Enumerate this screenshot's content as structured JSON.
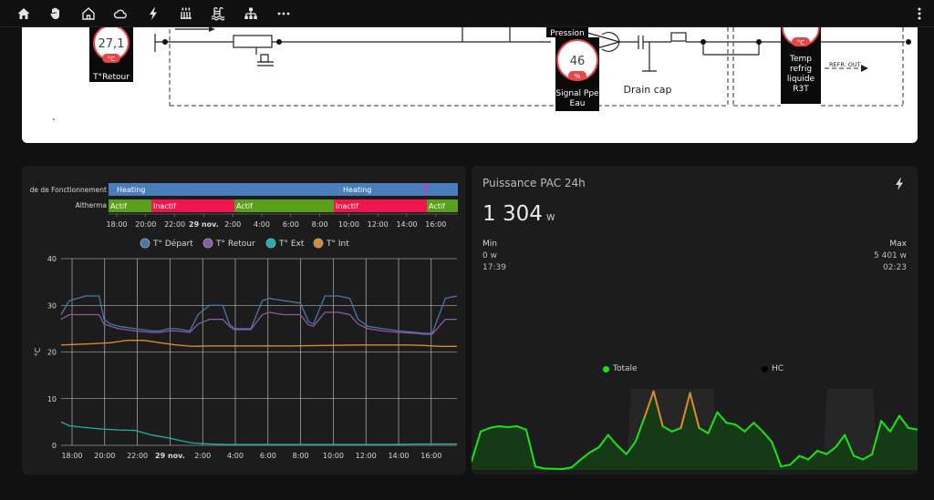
{
  "topbar": {
    "icons": [
      "home-icon",
      "hand-icon",
      "house-outline-icon",
      "cloud-icon",
      "lightning-icon",
      "radiator-icon",
      "pool-icon",
      "network-icon",
      "more-horizontal-icon"
    ],
    "menu_icon": "dots-vertical-icon"
  },
  "diagram": {
    "retour_value": "27,1",
    "retour_unit": "°C",
    "retour_label": "T°Retour",
    "pression_label": "Pression",
    "pump_value": "46",
    "pump_unit": "%",
    "pump_label_1": "Signal Ppe",
    "pump_label_2": "Eau",
    "drain_label": "Drain cap",
    "refrig_unit": "°C",
    "refrig_label_1": "Temp",
    "refrig_label_2": "refrig",
    "refrig_label_3": "liquide",
    "refrig_label_4": "R3T",
    "refr_out_label": "REFR. OUT"
  },
  "timeline": {
    "rows": [
      {
        "label": "de de Fonctionnement",
        "segments": [
          {
            "text": "Heating",
            "color": "#4a7ebb"
          },
          {
            "text": "Heating",
            "color": "#4a7ebb"
          }
        ]
      },
      {
        "label": "Altherma",
        "segments": [
          {
            "text": "Actif",
            "color": "#5a9e1a"
          },
          {
            "text": "Inactif",
            "color": "#f0154a"
          },
          {
            "text": "Actif",
            "color": "#5a9e1a"
          },
          {
            "text": "Inactif",
            "color": "#f0154a"
          },
          {
            "text": "Actif",
            "color": "#5a9e1a"
          }
        ]
      }
    ],
    "ticks": [
      "18:00",
      "20:00",
      "22:00",
      "29 nov.",
      "2:00",
      "4:00",
      "6:00",
      "8:00",
      "10:00",
      "12:00",
      "14:00",
      "16:00"
    ]
  },
  "chart_data": [
    {
      "type": "line",
      "ylabel": "°C",
      "ylim": [
        0,
        40
      ],
      "yticks": [
        "0",
        "10",
        "20",
        "30",
        "40"
      ],
      "x_ticks": [
        "18:00",
        "20:00",
        "22:00",
        "29 nov.",
        "2:00",
        "4:00",
        "6:00",
        "8:00",
        "10:00",
        "12:00",
        "14:00",
        "16:00"
      ],
      "x_hours": [
        0,
        24
      ],
      "legend": "top",
      "series": [
        {
          "name": "T° Départ",
          "color": "#4a77a8",
          "x": [
            0,
            0.5,
            1.5,
            2.3,
            2.6,
            3.0,
            3.5,
            4.5,
            5.5,
            6.0,
            6.5,
            7.0,
            7.8,
            8.3,
            9.0,
            9.8,
            10.2,
            10.5,
            11.5,
            12.2,
            12.6,
            13.5,
            14.5,
            15.0,
            15.3,
            16.0,
            16.8,
            17.5,
            18.0,
            18.6,
            19.5,
            20.5,
            21.5,
            22.0,
            22.5,
            23.3,
            24
          ],
          "y": [
            28,
            31,
            32,
            32,
            27,
            26,
            25.5,
            25,
            24.5,
            24.5,
            25,
            25,
            24.5,
            28,
            30,
            30,
            26,
            25,
            25,
            31,
            31.5,
            31,
            30.5,
            26.5,
            26,
            32,
            32,
            31.5,
            27,
            25.5,
            25,
            24.5,
            24.2,
            24,
            24,
            31.5,
            32
          ]
        },
        {
          "name": "T° Retour",
          "color": "#8a5ba3",
          "x": [
            0,
            0.5,
            1.5,
            2.3,
            2.6,
            3.0,
            3.5,
            4.5,
            5.5,
            6.0,
            6.5,
            7.0,
            7.8,
            8.3,
            9.0,
            9.8,
            10.2,
            10.5,
            11.5,
            12.2,
            12.6,
            13.5,
            14.5,
            15.0,
            15.3,
            16.0,
            16.8,
            17.5,
            18.0,
            18.6,
            19.5,
            20.5,
            21.5,
            22.0,
            22.5,
            23.3,
            24
          ],
          "y": [
            27,
            28,
            28,
            28,
            26,
            25.5,
            25,
            24.5,
            24.2,
            24.2,
            24.5,
            24.5,
            24.2,
            26,
            27,
            27,
            25.5,
            24.8,
            24.8,
            28,
            28.5,
            28,
            28,
            25.8,
            25.5,
            28.5,
            28.5,
            28,
            26,
            25,
            24.5,
            24.2,
            24,
            23.8,
            23.8,
            27,
            27
          ]
        },
        {
          "name": "T° Ext",
          "color": "#1fb0a8",
          "x": [
            0,
            0.5,
            1.5,
            2.5,
            3.5,
            4.5,
            5.5,
            6.5,
            7.5,
            8.0,
            9.0,
            10.0,
            12,
            14,
            16,
            18,
            20,
            22,
            24
          ],
          "y": [
            5,
            4.2,
            3.8,
            3.5,
            3.3,
            3.2,
            2.2,
            1.6,
            0.8,
            0.5,
            0.3,
            0.2,
            0.2,
            0.2,
            0.2,
            0.2,
            0.2,
            0.3,
            0.3
          ]
        },
        {
          "name": "T° Int",
          "color": "#d98a2a",
          "x": [
            0,
            2,
            3,
            4,
            5,
            6,
            7,
            8,
            9,
            10,
            12,
            14,
            16,
            18,
            20,
            21,
            22,
            23,
            24
          ],
          "y": [
            21.5,
            21.8,
            22,
            22.5,
            22.5,
            22,
            21.5,
            21.2,
            21.3,
            21.3,
            21.3,
            21.3,
            21.4,
            21.5,
            21.5,
            21.5,
            21.4,
            21.2,
            21.2
          ]
        }
      ]
    },
    {
      "type": "area",
      "series": [
        {
          "name": "Totale",
          "color": "#17e517",
          "values": [
            500,
            2200,
            2400,
            2500,
            2450,
            2500,
            2300,
            200,
            80,
            60,
            50,
            150,
            600,
            1000,
            1300,
            2000,
            1400,
            900,
            1600,
            3000,
            4500,
            2500,
            2200,
            2400,
            4400,
            2400,
            2100,
            3300,
            2700,
            2600,
            2200,
            2700,
            2200,
            1600,
            200,
            300,
            800,
            600,
            1100,
            900,
            1300,
            2000,
            800,
            600,
            900,
            2800,
            2200,
            3100,
            2400,
            2300
          ]
        },
        {
          "name": "HC",
          "color": "#000000"
        }
      ]
    }
  ],
  "power": {
    "title": "Puissance PAC 24h",
    "icon": "lightning-icon",
    "value": "1 304",
    "unit": "w",
    "min_label": "Min",
    "min_value": "0 w",
    "min_time": "17:39",
    "max_label": "Max",
    "max_value": "5 401 w",
    "max_time": "02:23"
  }
}
